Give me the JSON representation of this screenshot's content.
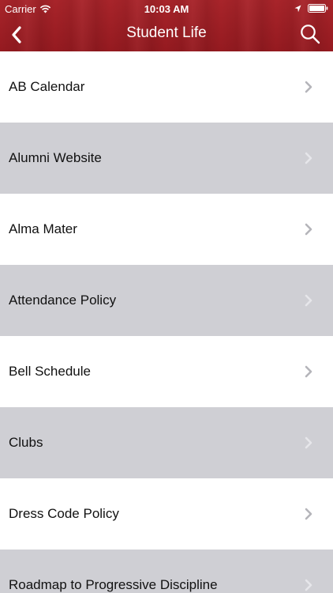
{
  "status_bar": {
    "carrier": "Carrier",
    "time": "10:03 AM"
  },
  "nav": {
    "title": "Student Life",
    "back_icon": "chevron-left-icon",
    "search_icon": "search-icon"
  },
  "colors": {
    "header": "#9e1c22",
    "row_alt": "#cfcfd4",
    "row": "#ffffff"
  },
  "list": {
    "items": [
      {
        "label": "AB Calendar"
      },
      {
        "label": "Alumni Website"
      },
      {
        "label": "Alma Mater"
      },
      {
        "label": "Attendance Policy"
      },
      {
        "label": "Bell Schedule"
      },
      {
        "label": "Clubs"
      },
      {
        "label": "Dress Code Policy"
      },
      {
        "label": "Roadmap to Progressive Discipline"
      }
    ]
  }
}
